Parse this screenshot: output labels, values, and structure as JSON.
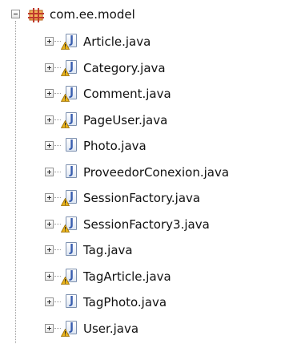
{
  "package": {
    "name": "com.ee.model",
    "icon": "package-icon",
    "expanded": true
  },
  "files": [
    {
      "name": "Article.java",
      "warning": true
    },
    {
      "name": "Category.java",
      "warning": true
    },
    {
      "name": "Comment.java",
      "warning": true
    },
    {
      "name": "PageUser.java",
      "warning": true
    },
    {
      "name": "Photo.java",
      "warning": false
    },
    {
      "name": "ProveedorConexion.java",
      "warning": false
    },
    {
      "name": "SessionFactory.java",
      "warning": true
    },
    {
      "name": "SessionFactory3.java",
      "warning": true
    },
    {
      "name": "Tag.java",
      "warning": false
    },
    {
      "name": "TagArticle.java",
      "warning": true
    },
    {
      "name": "TagPhoto.java",
      "warning": false
    },
    {
      "name": "User.java",
      "warning": true
    }
  ],
  "colors": {
    "warning": "#e8b21c",
    "package": "#d9822b",
    "java_icon": "#3a5fb0"
  }
}
